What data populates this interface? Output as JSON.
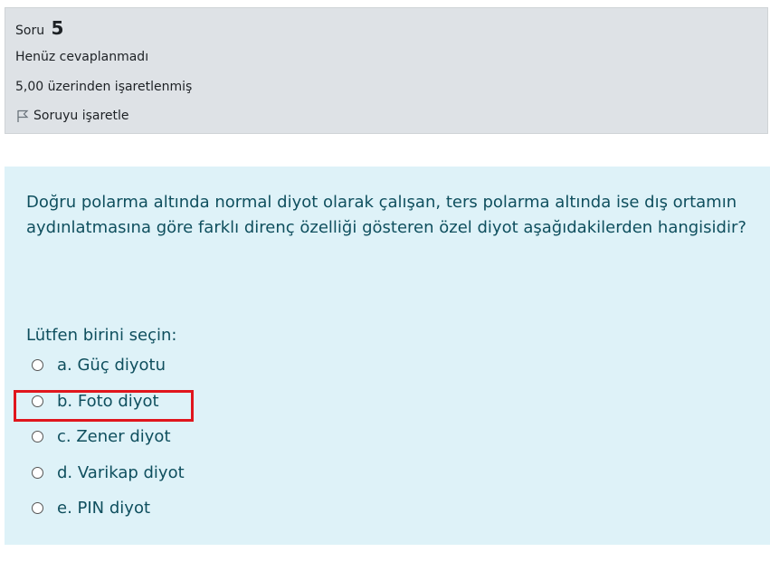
{
  "info": {
    "label": "Soru",
    "number": "5",
    "state": "Henüz cevaplanmadı",
    "grade": "5,00 üzerinden işaretlenmiş",
    "flag_label": "Soruyu işaretle"
  },
  "question": {
    "text": "Doğru polarma altında normal diyot olarak çalışan, ters polarma altında ise dış ortamın aydınlatmasına göre farklı direnç özelliği gösteren özel diyot aşağıdakilerden hangisidir?",
    "prompt": "Lütfen birini seçin:",
    "answers": [
      "a. Güç diyotu",
      "b. Foto diyot",
      "c. Zener diyot",
      "d. Varikap diyot",
      "e. PIN diyot"
    ]
  },
  "colors": {
    "info_bg": "#dee2e6",
    "question_bg": "#def2f8",
    "question_text": "#0f4f5e",
    "highlight_border": "#e0161d"
  }
}
